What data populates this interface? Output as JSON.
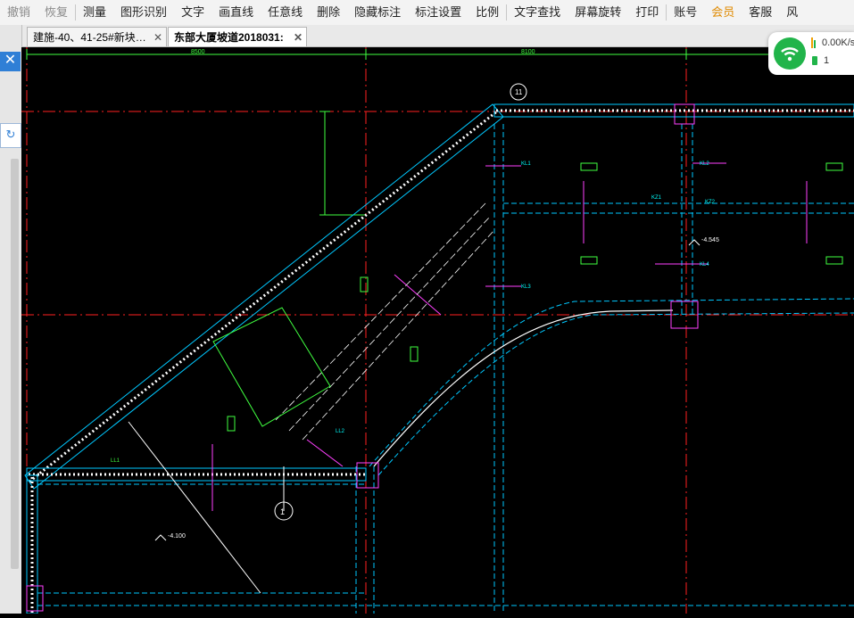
{
  "toolbar": {
    "items": [
      {
        "label": "撤销",
        "state": "disabled"
      },
      {
        "label": "恢复",
        "state": "disabled"
      },
      {
        "label": "测量",
        "state": "normal"
      },
      {
        "label": "图形识别",
        "state": "normal"
      },
      {
        "label": "文字",
        "state": "normal"
      },
      {
        "label": "画直线",
        "state": "normal"
      },
      {
        "label": "任意线",
        "state": "normal"
      },
      {
        "label": "删除",
        "state": "normal"
      },
      {
        "label": "隐藏标注",
        "state": "normal"
      },
      {
        "label": "标注设置",
        "state": "normal"
      },
      {
        "label": "比例",
        "state": "normal"
      },
      {
        "label": "文字查找",
        "state": "normal"
      },
      {
        "label": "屏幕旋转",
        "state": "normal"
      },
      {
        "label": "打印",
        "state": "normal"
      },
      {
        "label": "账号",
        "state": "normal"
      },
      {
        "label": "会员",
        "state": "vip"
      },
      {
        "label": "客服",
        "state": "normal"
      },
      {
        "label": "风",
        "state": "normal"
      }
    ]
  },
  "tabs": [
    {
      "label": "建施-40、41-25#新块…",
      "close": "✕",
      "active": false
    },
    {
      "label": "东部大厦坡道2018031:",
      "close": "✕",
      "active": true
    }
  ],
  "left_panel": {
    "close_glyph": "✕",
    "refresh_glyph": "↻"
  },
  "network_widget": {
    "speed": "0.00K/s",
    "count": "1",
    "accent": "#21b44a"
  },
  "drawing": {
    "top_dims": [
      "8500",
      "8100"
    ],
    "axis_label": "11",
    "bottom_axis_label": "1",
    "elevations": [
      "-4.545",
      "-4.100",
      "-4.100"
    ],
    "beam_labels": [
      "KL1",
      "KL2",
      "KL3",
      "KL4",
      "KZ1",
      "KZ2",
      "LL1",
      "LL2"
    ]
  },
  "colors": {
    "canvas": "#000000",
    "axis": "#ff2020",
    "wall": "#00c8ff",
    "slab": "#ffffff",
    "dim": "#40ff40",
    "annotation": "#ff40ff",
    "text": "#ffff40"
  }
}
